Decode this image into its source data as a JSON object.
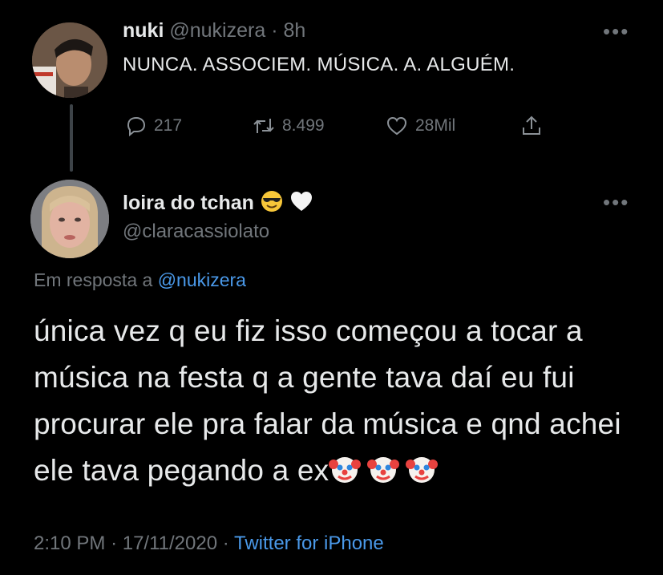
{
  "reply_context": {
    "user": {
      "name": "nuki",
      "handle": "@nukizera",
      "time": "8h"
    },
    "text": "NUNCA. ASSOCIEM. MÚSICA. A. ALGUÉM.",
    "stats": {
      "replies": "217",
      "retweets": "8.499",
      "likes": "28Mil"
    },
    "icons": [
      "reply-icon",
      "retweet-icon",
      "like-icon",
      "share-icon",
      "more-icon"
    ]
  },
  "main_tweet": {
    "user": {
      "name": "loira do tchan",
      "handle": "@claracassiolato",
      "name_emojis": [
        "sunglasses-emoji",
        "white-heart-emoji"
      ]
    },
    "reply_prefix": "Em resposta a",
    "reply_mention": "@nukizera",
    "text": "única vez q eu fiz isso começou a tocar a música na festa q a gente tava daí eu fui procurar ele pra falar da música e qnd achei ele tava pegando a ex",
    "trailing_emojis": [
      "clown-emoji",
      "clown-emoji",
      "clown-emoji"
    ],
    "meta": {
      "time": "2:10 PM",
      "date": "17/11/2020",
      "source": "Twitter for iPhone"
    }
  },
  "colors": {
    "background": "#000000",
    "text": "#e7e9ea",
    "muted": "#71767b",
    "link": "#4a99e9",
    "thread_line": "#3d4348"
  }
}
